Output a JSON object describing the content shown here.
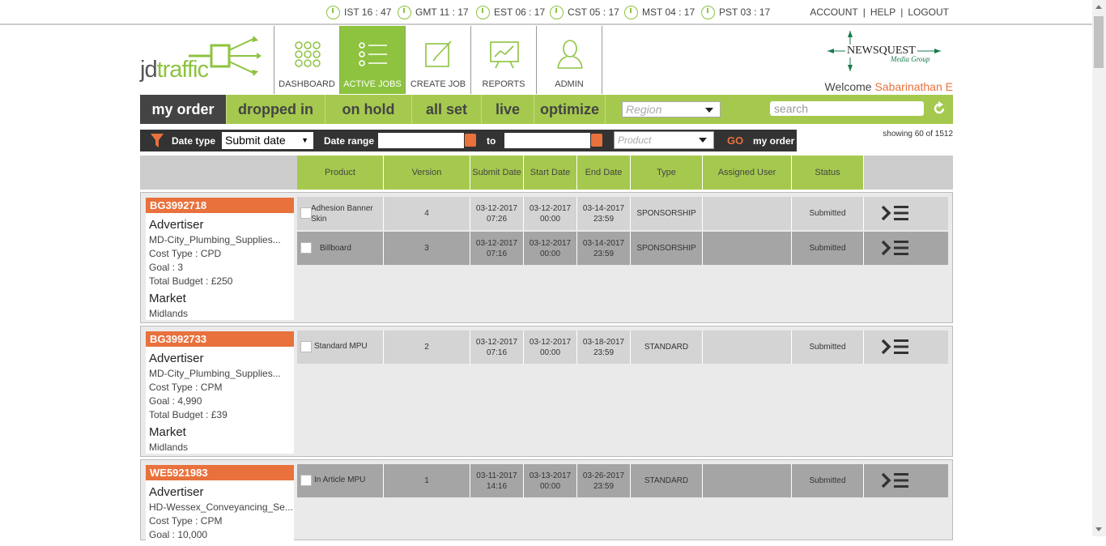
{
  "timezones": [
    {
      "label": "IST 16 : 47"
    },
    {
      "label": "GMT 11 : 17"
    },
    {
      "label": "EST 06 : 17"
    },
    {
      "label": "CST 05 : 17"
    },
    {
      "label": "MST 04 : 17"
    },
    {
      "label": "PST 03 : 17"
    }
  ],
  "account_links": {
    "account": "ACCOUNT",
    "help": "HELP",
    "logout": "LOGOUT",
    "sep": "|"
  },
  "logo": {
    "jd": "jd",
    "traffic": "traffic"
  },
  "nav": [
    {
      "label": "DASHBOARD"
    },
    {
      "label": "ACTIVE JOBS"
    },
    {
      "label": "CREATE JOB"
    },
    {
      "label": "REPORTS"
    },
    {
      "label": "ADMIN"
    }
  ],
  "partner": {
    "name": "NEWSQUEST",
    "sub": "Media Group"
  },
  "welcome": {
    "text": "Welcome",
    "user": "Sabarinathan E"
  },
  "status_tabs": [
    {
      "label": "my order"
    },
    {
      "label": "dropped in"
    },
    {
      "label": "on hold"
    },
    {
      "label": "all set"
    },
    {
      "label": "live"
    },
    {
      "label": "optimize"
    }
  ],
  "region": {
    "placeholder": "Region"
  },
  "search": {
    "placeholder": "search"
  },
  "filter": {
    "date_type_label": "Date type",
    "date_type_value": "Submit date",
    "date_range_label": "Date range",
    "to_label": "to",
    "from_value": "",
    "to_value": "",
    "product_placeholder": "Product",
    "go_label": "GO",
    "my_order_label": "my order"
  },
  "showing": "showing 60 of 1512",
  "columns": [
    "Product",
    "Version",
    "Submit Date",
    "Start Date",
    "End Date",
    "Type",
    "Assigned User",
    "Status"
  ],
  "orders": [
    {
      "id": "BG3992718",
      "advertiser_label": "Advertiser",
      "advertiser": "MD-City_Plumbing_Supplies...",
      "cost_type": "Cost Type : CPD",
      "goal": "Goal : 3",
      "budget": "Total Budget : £250",
      "market_label": "Market",
      "market": "Midlands",
      "lines": [
        {
          "product": "Adhesion Banner Skin",
          "version": "4",
          "submit_date": "03-12-2017",
          "submit_time": "07:26",
          "start_date": "03-12-2017",
          "start_time": "00:00",
          "end_date": "03-14-2017",
          "end_time": "23:59",
          "type": "SPONSORSHIP",
          "assigned_user": "",
          "status": "Submitted"
        },
        {
          "product": "Billboard",
          "version": "3",
          "submit_date": "03-12-2017",
          "submit_time": "07:16",
          "start_date": "03-12-2017",
          "start_time": "00:00",
          "end_date": "03-14-2017",
          "end_time": "23:59",
          "type": "SPONSORSHIP",
          "assigned_user": "",
          "status": "Submitted"
        }
      ]
    },
    {
      "id": "BG3992733",
      "advertiser_label": "Advertiser",
      "advertiser": "MD-City_Plumbing_Supplies...",
      "cost_type": "Cost Type : CPM",
      "goal": "Goal : 4,990",
      "budget": "Total Budget : £39",
      "market_label": "Market",
      "market": "Midlands",
      "lines": [
        {
          "product": "Standard MPU",
          "version": "2",
          "submit_date": "03-12-2017",
          "submit_time": "07:16",
          "start_date": "03-12-2017",
          "start_time": "00:00",
          "end_date": "03-18-2017",
          "end_time": "23:59",
          "type": "STANDARD",
          "assigned_user": "",
          "status": "Submitted"
        }
      ]
    },
    {
      "id": "WE5921983",
      "advertiser_label": "Advertiser",
      "advertiser": "HD-Wessex_Conveyancing_Se...",
      "cost_type": "Cost Type : CPM",
      "goal": "Goal : 10,000",
      "budget": "",
      "market_label": "",
      "market": "",
      "lines": [
        {
          "product": "In Article MPU",
          "version": "1",
          "submit_date": "03-11-2017",
          "submit_time": "14:16",
          "start_date": "03-13-2017",
          "start_time": "00:00",
          "end_date": "03-26-2017",
          "end_time": "23:59",
          "type": "STANDARD",
          "assigned_user": "",
          "status": "Submitted"
        }
      ]
    }
  ],
  "colors": {
    "accent_green": "#a5c94e",
    "active_green": "#8dc33f",
    "orange": "#e8713c",
    "dark": "#333333"
  }
}
